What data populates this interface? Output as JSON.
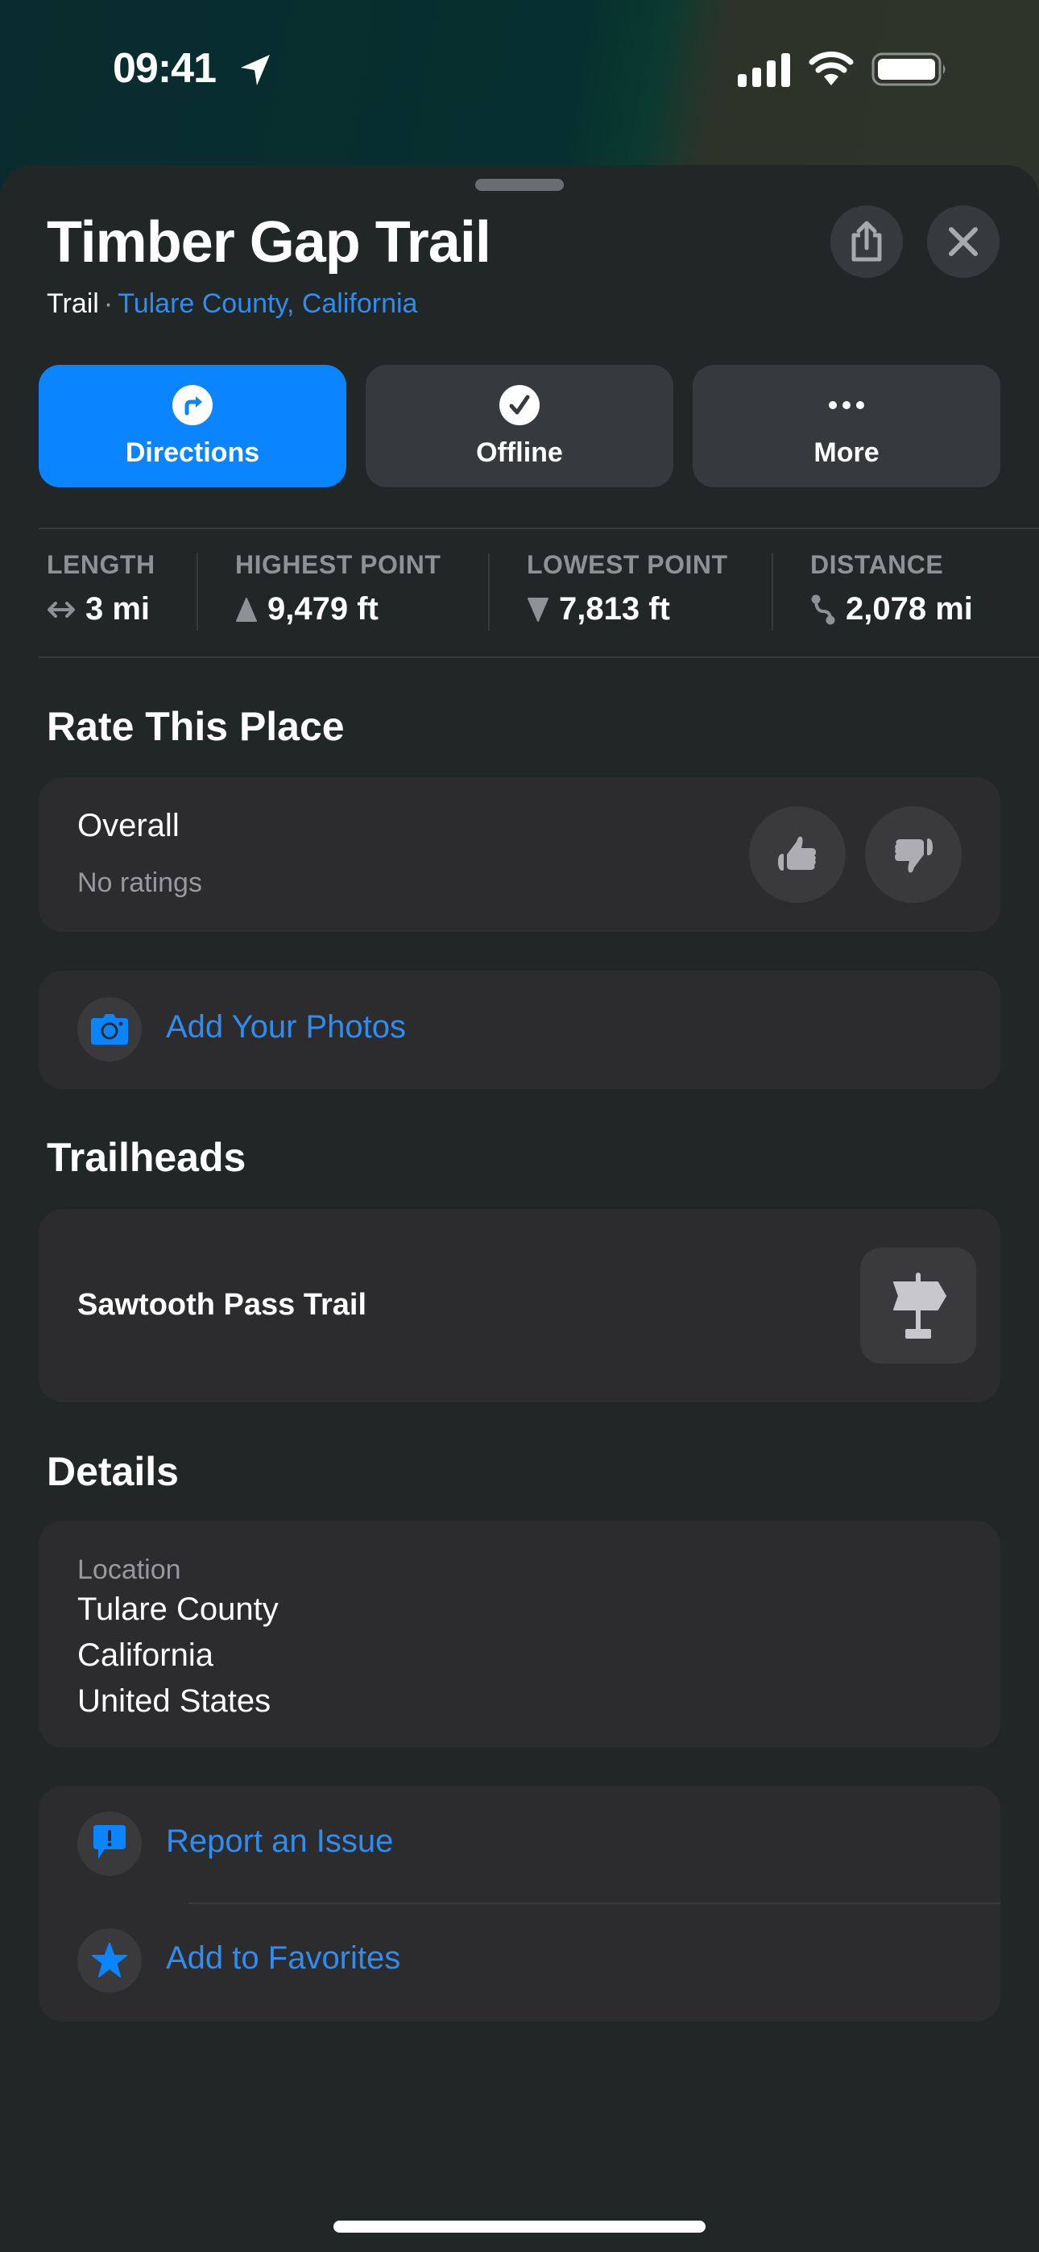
{
  "status_bar": {
    "time": "09:41",
    "icons": [
      "location-arrow-icon",
      "cellular-signal-icon",
      "wifi-icon",
      "battery-icon"
    ]
  },
  "header": {
    "title": "Timber Gap Trail",
    "category": "Trail",
    "separator": "·",
    "location_link": "Tulare County, California",
    "share_icon": "share-icon",
    "close_icon": "close-icon"
  },
  "actions": [
    {
      "label": "Directions",
      "icon": "turn-right-arrow-icon",
      "primary": true
    },
    {
      "label": "Offline",
      "icon": "checkmark-circle-icon",
      "primary": false
    },
    {
      "label": "More",
      "icon": "ellipsis-icon",
      "primary": false
    }
  ],
  "stats": [
    {
      "label": "LENGTH",
      "value": "3 mi",
      "icon": "left-right-arrow-icon"
    },
    {
      "label": "HIGHEST POINT",
      "value": "9,479 ft",
      "icon": "triangle-up-icon"
    },
    {
      "label": "LOWEST POINT",
      "value": "7,813 ft",
      "icon": "triangle-down-icon"
    },
    {
      "label": "DISTANCE",
      "value": "2,078 mi",
      "icon": "route-icon"
    }
  ],
  "rating": {
    "section_title": "Rate This Place",
    "overall_label": "Overall",
    "status": "No ratings",
    "thumbs_up_icon": "thumbs-up-icon",
    "thumbs_down_icon": "thumbs-down-icon"
  },
  "photos": {
    "label": "Add Your Photos",
    "icon": "camera-icon"
  },
  "trailheads": {
    "section_title": "Trailheads",
    "items": [
      {
        "name": "Sawtooth Pass Trail",
        "icon": "signpost-icon"
      }
    ]
  },
  "details": {
    "section_title": "Details",
    "location_label": "Location",
    "location_lines": [
      "Tulare County",
      "California",
      "United States"
    ]
  },
  "links": [
    {
      "label": "Report an Issue",
      "icon": "report-issue-icon"
    },
    {
      "label": "Add to Favorites",
      "icon": "star-icon"
    }
  ],
  "colors": {
    "accent": "#0a84ff",
    "link": "#2f8cf0",
    "sheet_background": "#212627",
    "card_background": "#2c2c2e"
  }
}
